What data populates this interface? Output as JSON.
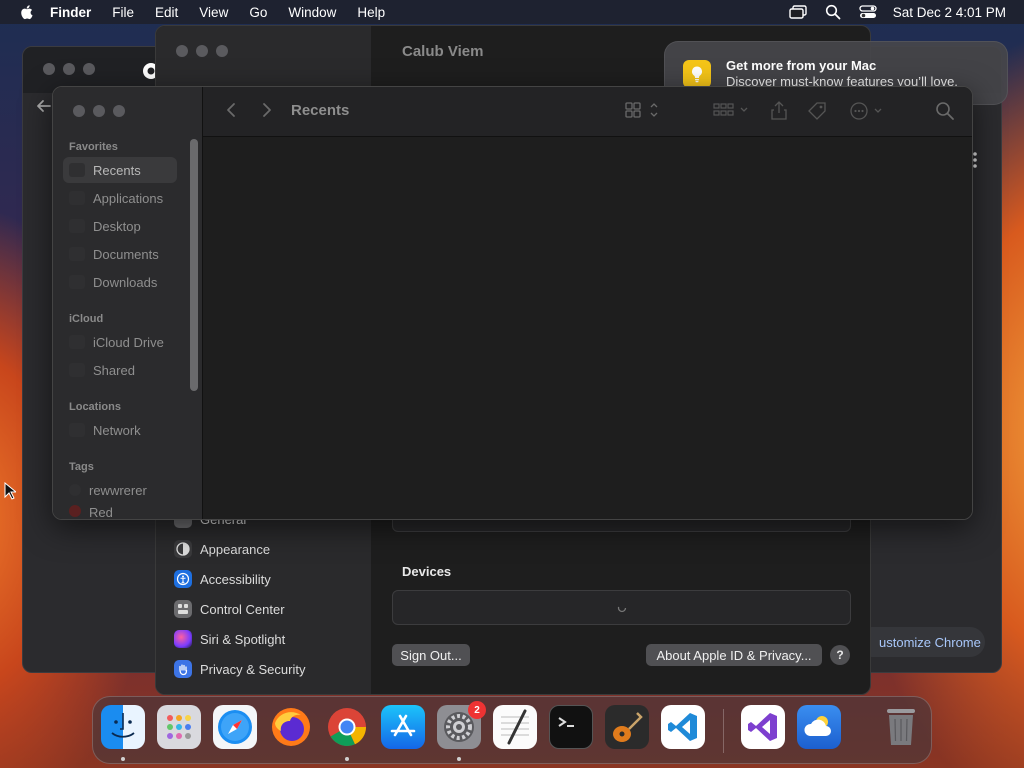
{
  "menubar": {
    "app_name": "Finder",
    "menus": [
      "File",
      "Edit",
      "View",
      "Go",
      "Window",
      "Help"
    ],
    "clock": "Sat Dec 2  4:01 PM",
    "status_icons": [
      "screen-mirroring-icon",
      "spotlight-search-icon",
      "control-center-icon"
    ]
  },
  "chrome": {
    "customize_label": "ustomize Chrome"
  },
  "settings": {
    "title": "Calub Viem",
    "sidebar_items": [
      {
        "label": "General",
        "icon": "gear-icon",
        "color": "#6b6b6e"
      },
      {
        "label": "Appearance",
        "icon": "appearance-icon",
        "color": "#3a3a3c"
      },
      {
        "label": "Accessibility",
        "icon": "accessibility-icon",
        "color": "#1e6fe0"
      },
      {
        "label": "Control Center",
        "icon": "control-center-icon",
        "color": "#6b6b6e"
      },
      {
        "label": "Siri & Spotlight",
        "icon": "siri-icon",
        "color": "#a24bd6"
      },
      {
        "label": "Privacy & Security",
        "icon": "hand-icon",
        "color": "#3d74e6"
      }
    ],
    "devices_title": "Devices",
    "sign_out_label": "Sign Out...",
    "about_label": "About Apple ID & Privacy...",
    "help_label": "?"
  },
  "notification": {
    "title": "Get more from your Mac",
    "body": "Discover must-know features you’ll love."
  },
  "finder": {
    "title": "Recents",
    "sections": [
      {
        "label": "Favorites",
        "items": [
          "Recents",
          "Applications",
          "Desktop",
          "Documents",
          "Downloads"
        ]
      },
      {
        "label": "iCloud",
        "items": [
          "iCloud Drive",
          "Shared"
        ]
      },
      {
        "label": "Locations",
        "items": [
          "Network"
        ]
      },
      {
        "label": "Tags",
        "items": [
          "rewwrerer",
          "Red"
        ]
      }
    ],
    "selected": "Recents"
  },
  "dock": {
    "apps": [
      "Finder",
      "Launchpad",
      "Safari",
      "Firefox",
      "Google Chrome",
      "App Store",
      "System Settings",
      "TextEdit",
      "Terminal",
      "GarageBand",
      "Visual Studio Code",
      "Visual Studio",
      "Weather",
      "Trash"
    ],
    "settings_badge": "2"
  },
  "colors": {
    "accent": "#1e6fe0",
    "window_bg": "#1e1e1e",
    "sidebar_bg": "#2b2b2d",
    "notification_icon": "#f5c518",
    "badge": "#e33333"
  }
}
